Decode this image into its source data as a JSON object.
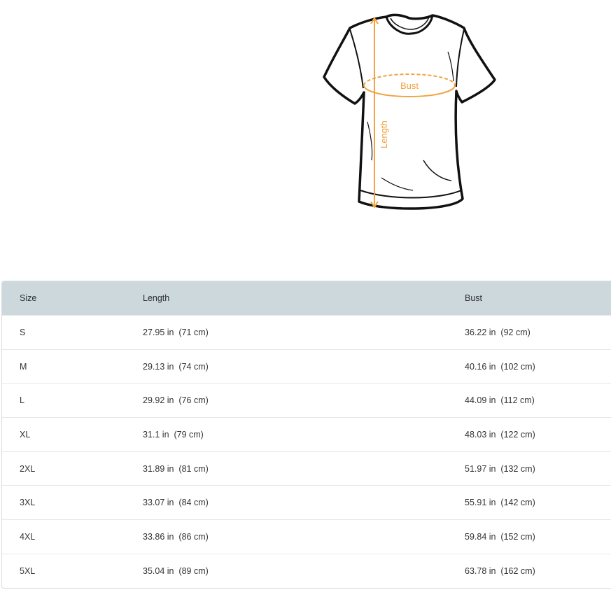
{
  "diagram": {
    "bust_label": "Bust",
    "length_label": "Length",
    "accent_color": "#f0a33f"
  },
  "table": {
    "headers": {
      "size": "Size",
      "length": "Length",
      "bust": "Bust"
    },
    "rows": [
      {
        "size": "S",
        "length": "27.95 in  (71 cm)",
        "bust": "36.22 in  (92 cm)"
      },
      {
        "size": "M",
        "length": "29.13 in  (74 cm)",
        "bust": "40.16 in  (102 cm)"
      },
      {
        "size": "L",
        "length": "29.92 in  (76 cm)",
        "bust": "44.09 in  (112 cm)"
      },
      {
        "size": "XL",
        "length": "31.1 in  (79 cm)",
        "bust": "48.03 in  (122 cm)"
      },
      {
        "size": "2XL",
        "length": "31.89 in  (81 cm)",
        "bust": "51.97 in  (132 cm)"
      },
      {
        "size": "3XL",
        "length": "33.07 in  (84 cm)",
        "bust": "55.91 in  (142 cm)"
      },
      {
        "size": "4XL",
        "length": "33.86 in  (86 cm)",
        "bust": "59.84 in  (152 cm)"
      },
      {
        "size": "5XL",
        "length": "35.04 in  (89 cm)",
        "bust": "63.78 in  (162 cm)"
      }
    ]
  }
}
